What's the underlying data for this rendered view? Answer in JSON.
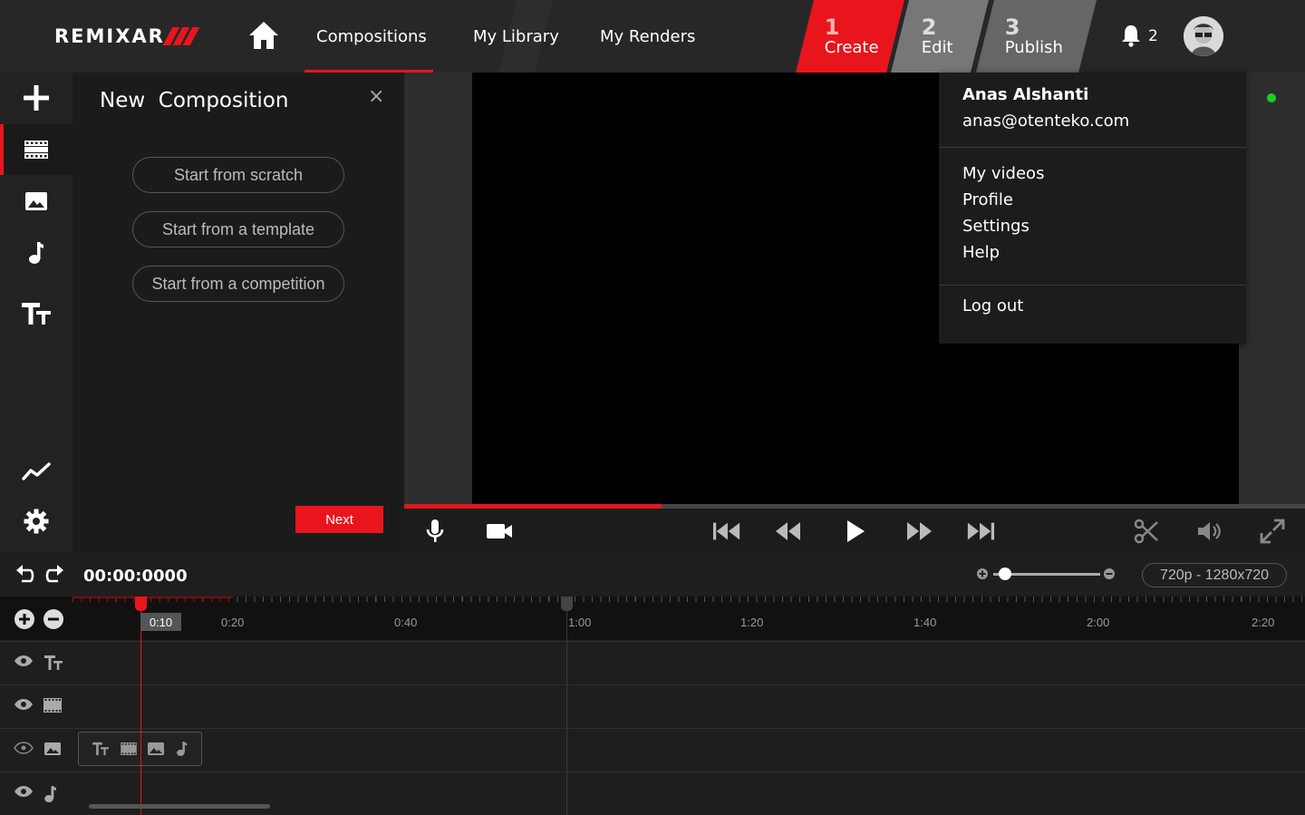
{
  "header": {
    "logo_text": "REMIXAR",
    "nav": [
      "Compositions",
      "My Library",
      "My Renders"
    ],
    "steps": [
      {
        "num": "1",
        "label": "Create",
        "active": true
      },
      {
        "num": "2",
        "label": "Edit",
        "active": false
      },
      {
        "num": "3",
        "label": "Publish",
        "active": false
      }
    ],
    "notification_count": "2"
  },
  "toolbar": {
    "items": [
      "plus-icon",
      "film-icon",
      "image-icon",
      "music-icon",
      "text-icon",
      "analytics-icon",
      "settings-icon"
    ],
    "active": "film-icon"
  },
  "panel": {
    "title": "New  Composition",
    "close": "×",
    "options": [
      "Start from scratch",
      "Start from a template",
      "Start from a competition"
    ],
    "next_label": "Next"
  },
  "user_menu": {
    "name": "Anas Alshanti",
    "email": "anas@otenteko.com",
    "items": [
      "My videos",
      "Profile",
      "Settings",
      "Help"
    ],
    "logout": "Log out",
    "status": "online"
  },
  "player": {
    "progress_fraction": 0.286
  },
  "timeline": {
    "timecode": "00:00:0000",
    "resolution": "720p - 1280x720",
    "playhead_label": "0:10",
    "ticks": [
      "0:20",
      "0:40",
      "1:00",
      "1:20",
      "1:40",
      "2:00",
      "2:20"
    ],
    "tracks": [
      "text-icon",
      "film-icon",
      "image-icon",
      "music-icon"
    ]
  },
  "colors": {
    "accent": "#e8151d",
    "background": "#1f1f1f",
    "online": "#1bd11b"
  }
}
